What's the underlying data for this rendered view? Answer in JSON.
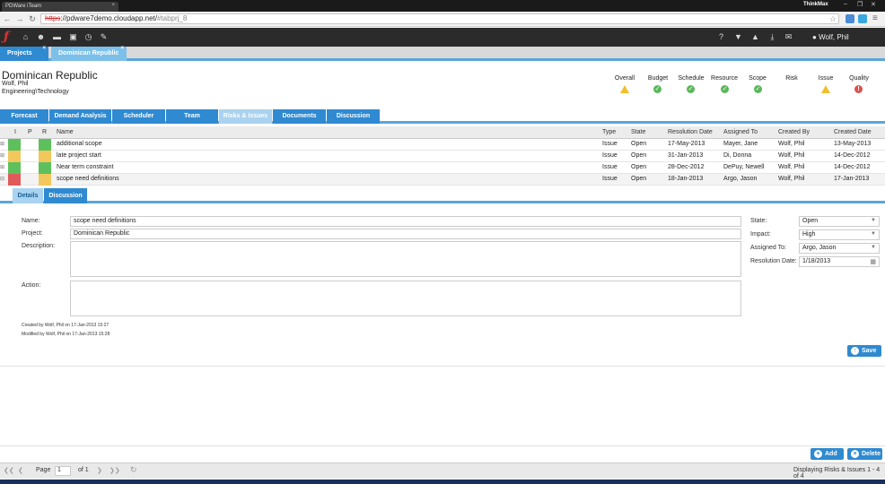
{
  "browser": {
    "tab_title": "PDWare iTeam",
    "window_label": "ThinkMax",
    "url_scheme": "https",
    "url_host": "://pdware7demo.cloudapp.net/",
    "url_hash": "#tabprj_8"
  },
  "app": {
    "user": "Wolf, Phil",
    "project_tabs": [
      "Projects",
      "Dominican Republic"
    ]
  },
  "project": {
    "title": "Dominican Republic",
    "owner": "Wolf, Phil",
    "department": "Engineering\\Technology"
  },
  "status": [
    {
      "label": "Overall",
      "state": "warning"
    },
    {
      "label": "Budget",
      "state": "ok"
    },
    {
      "label": "Schedule",
      "state": "ok"
    },
    {
      "label": "Resource",
      "state": "ok"
    },
    {
      "label": "Scope",
      "state": "ok"
    },
    {
      "label": "Risk",
      "state": "none"
    },
    {
      "label": "Issue",
      "state": "warning"
    },
    {
      "label": "Quality",
      "state": "error"
    }
  ],
  "section_tabs": [
    "Forecast",
    "Demand Analysis",
    "Scheduler",
    "Team",
    "Risks & Issues",
    "Documents",
    "Discussion"
  ],
  "active_section": "Risks & Issues",
  "grid": {
    "headers": [
      "I",
      "P",
      "R",
      "Name",
      "Type",
      "State",
      "Resolution Date",
      "Assigned To",
      "Created By",
      "Created Date"
    ],
    "rows": [
      {
        "name": "additional scope",
        "type": "Issue",
        "state": "Open",
        "resolution": "17-May-2013",
        "assigned": "Mayer, Jane",
        "created_by": "Wolf, Phil",
        "created": "13-May-2013",
        "colors": [
          "#5cc15c",
          "#5cc15c"
        ]
      },
      {
        "name": "late project start",
        "type": "Issue",
        "state": "Open",
        "resolution": "31-Jan-2013",
        "assigned": "Di, Donna",
        "created_by": "Wolf, Phil",
        "created": "14-Dec-2012",
        "colors": [
          "#f2c75b",
          "#f2c75b"
        ]
      },
      {
        "name": "Near term constraint",
        "type": "Issue",
        "state": "Open",
        "resolution": "28-Dec-2012",
        "assigned": "DePuy, Newell",
        "created_by": "Wolf, Phil",
        "created": "14-Dec-2012",
        "colors": [
          "#5cc15c",
          "#5cc15c"
        ]
      },
      {
        "name": "scope need definitions",
        "type": "Issue",
        "state": "Open",
        "resolution": "18-Jan-2013",
        "assigned": "Argo, Jason",
        "created_by": "Wolf, Phil",
        "created": "17-Jan-2013",
        "colors": [
          "#e05a5a",
          "#f2c75b"
        ]
      }
    ]
  },
  "detail": {
    "tabs": [
      "Details",
      "Discussion"
    ],
    "name_label": "Name:",
    "name_value": "scope need definitions",
    "project_label": "Project:",
    "project_value": "Dominican Republic",
    "description_label": "Description:",
    "action_label": "Action:",
    "state_label": "State:",
    "state_value": "Open",
    "impact_label": "Impact:",
    "impact_value": "High",
    "assigned_label": "Assigned To:",
    "assigned_value": "Argo, Jason",
    "resdate_label": "Resolution Date:",
    "resdate_value": "1/18/2013",
    "created_meta": "Created by Wolf, Phil on 17-Jan-2013 15:27",
    "modified_meta": "Modified by Wolf, Phil on 17-Jan-2013 15:28",
    "save_label": "Save"
  },
  "footer": {
    "add_label": "Add",
    "delete_label": "Delete",
    "page_label": "Page",
    "page_value": "1",
    "of_label": "of 1",
    "display_text": "Displaying Risks & Issues 1 - 4 of 4"
  }
}
